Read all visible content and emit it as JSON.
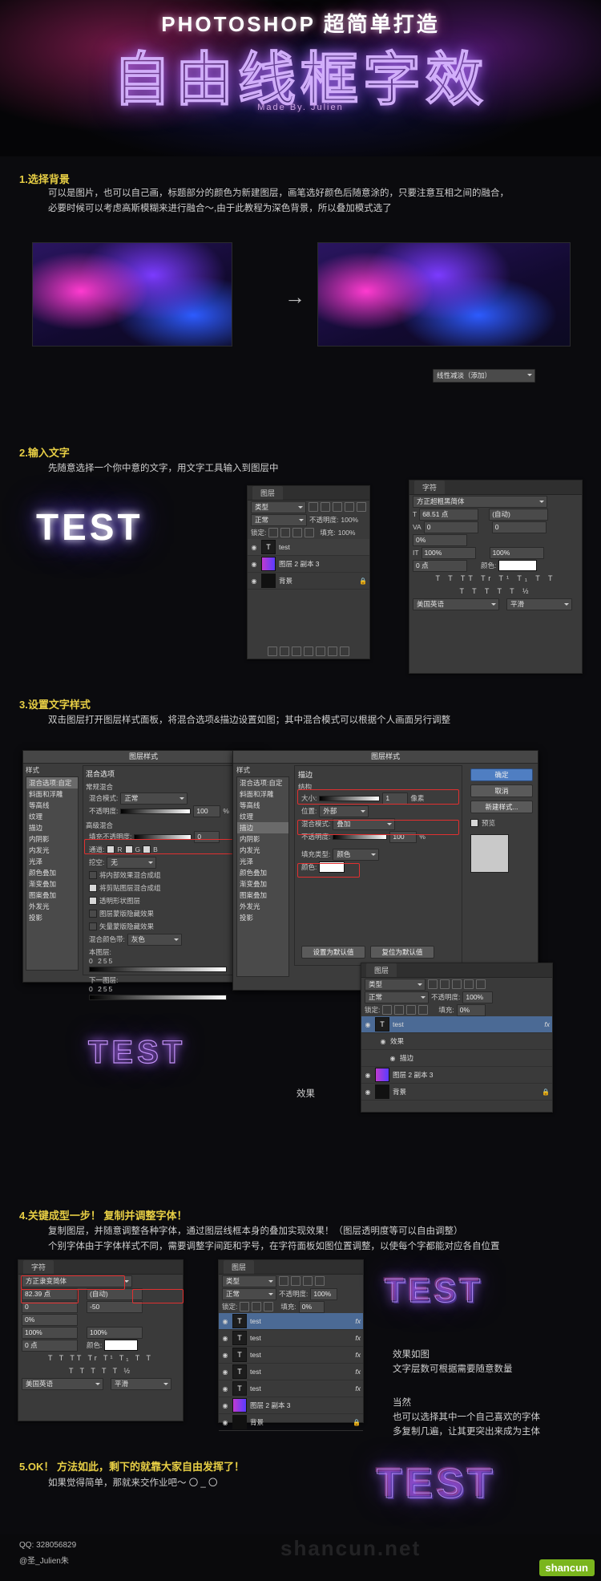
{
  "hero": {
    "title": "PHOTOSHOP  超简单打造",
    "main": "自由线框字效",
    "made_by": "Made By. Julien"
  },
  "steps": [
    {
      "heading": "1.选择背景",
      "body": "可以是图片，也可以自己画，标题部分的颜色为新建图层，画笔选好颜色后随意涂的，只要注意互相之间的融合，\n必要时候可以考虑高斯模糊来进行融合～,由于此教程为深色背景，所以叠加模式选了",
      "blend_mode": "线性减淡（添加）",
      "arrow": "→"
    },
    {
      "heading": "2.输入文字",
      "body": "先随意选择一个你中意的文字，用文字工具输入到图层中",
      "sample_text": "TEST"
    },
    {
      "heading": "3.设置文字样式",
      "body": "双击图层打开图层样式面板，将混合选项&描边设置如图；其中混合模式可以根据个人画面另行调整",
      "result_label": "效果",
      "sample_text": "TEST"
    },
    {
      "heading": "4.关键成型一步！ 复制并调整字体！",
      "body": "复制图层，并随意调整各种字体，通过图层线框本身的叠加实现效果！（图层透明度等可以自由调整）\n个别字体由于字体样式不同，需要调整字间距和字号，在字符面板如图位置调整，以使每个字都能对应各自位置",
      "sample_text": "TEST",
      "note1": "效果如图",
      "note2": "文字层数可根据需要随意数量",
      "note3": "当然",
      "note4": "也可以选择其中一个自己喜欢的字体",
      "note5": "多复制几遍，让其更突出来成为主体"
    },
    {
      "heading": "5.OK！ 方法如此，剩下的就靠大家自由发挥了！",
      "body": "如果觉得简单，那就来交作业吧～  〇 _ 〇",
      "sample_text": "TEST"
    }
  ],
  "panels": {
    "layers_step2": {
      "tab": "图层",
      "filter_kind": "类型",
      "blend_mode": "正常",
      "opacity_label": "不透明度:",
      "opacity_value": "100%",
      "lock_label": "锁定:",
      "fill_label": "填充:",
      "fill_value": "100%",
      "rows": [
        {
          "name": "test",
          "kind": "T"
        },
        {
          "name": "图层 2 副本 3",
          "kind": "img"
        },
        {
          "name": "背景",
          "kind": "bg",
          "locked": "🔒"
        }
      ]
    },
    "character_step2": {
      "tab": "字符",
      "font": "方正超粗黑简体",
      "size_icon": "T",
      "size": "68.51 点",
      "leading": "(自动)",
      "kerning_icon": "VA",
      "kerning": "0",
      "tracking": "0",
      "vscale_icon": "IT",
      "vscale": "100%",
      "hscale": "100%",
      "baseline": "0 点",
      "color_label": "颜色:",
      "percent": "0%",
      "style_row": "T T TT Tr T¹ T₁ T T",
      "frac_row": "T T T T T ½",
      "language": "美国英语",
      "aa": "平滑"
    },
    "layer_style_1": {
      "title": "图层样式",
      "styles_label": "样式",
      "list": [
        "混合选项:自定",
        "斜面和浮雕",
        "等高线",
        "纹理",
        "描边",
        "内阴影",
        "内发光",
        "光泽",
        "颜色叠加",
        "渐变叠加",
        "图案叠加",
        "外发光",
        "投影"
      ],
      "section": "混合选项",
      "general_label": "常规混合",
      "blend_label": "混合模式:",
      "blend_value": "正常",
      "opacity_label": "不透明度:",
      "opacity_value": "100",
      "adv_label": "高级混合",
      "fill_opacity_label": "填充不透明度:",
      "fill_opacity_value": "0",
      "channels_label": "通道:",
      "ch_r": "R",
      "ch_g": "G",
      "ch_b": "B",
      "knockout_label": "挖空:",
      "knockout_value": "无",
      "checks": [
        "将内部效果混合成组",
        "将剪贴图层混合成组",
        "透明形状图层",
        "图层蒙版隐藏效果",
        "矢量蒙版隐藏效果"
      ],
      "blend_if_label": "混合颜色带:",
      "blend_if_value": "灰色",
      "this_layer": "本图层:",
      "this_range": "0        255",
      "under_layer": "下一图层:",
      "under_range": "0        255"
    },
    "layer_style_2": {
      "title": "图层样式",
      "styles_label": "样式",
      "section": "描边",
      "structure_label": "结构",
      "size_label": "大小:",
      "size_value": "1",
      "size_unit": "像素",
      "position_label": "位置:",
      "position_value": "外部",
      "blend_label": "混合模式:",
      "blend_value": "叠加",
      "opacity_label": "不透明度:",
      "opacity_value": "100",
      "fill_type_label": "填充类型:",
      "fill_type_value": "颜色",
      "color_label": "颜色:",
      "reset_default": "设置为默认值",
      "restore_default": "复位为默认值",
      "ok": "确定",
      "cancel": "取消",
      "new_style": "新建样式...",
      "preview": "预览"
    },
    "layers_step3": {
      "tab": "图层",
      "filter_kind": "类型",
      "blend_mode": "正常",
      "opacity_label": "不透明度:",
      "opacity_value": "100%",
      "lock_label": "锁定:",
      "fill_label": "填充:",
      "fill_value": "0%",
      "rows": [
        {
          "name": "test",
          "kind": "T",
          "fx": "fx"
        },
        {
          "name": "效果",
          "kind": "sub"
        },
        {
          "name": "描边",
          "kind": "sub2"
        },
        {
          "name": "图层 2 副本 3",
          "kind": "img"
        },
        {
          "name": "背景",
          "kind": "bg",
          "locked": "🔒"
        }
      ]
    },
    "character_step4": {
      "tab": "字符",
      "font": "方正隶变简体",
      "size": "82.39 点",
      "leading": "(自动)",
      "kerning": "0",
      "tracking": "-50",
      "percent": "0%",
      "vscale": "100%",
      "hscale": "100%",
      "baseline": "0 点",
      "color_label": "颜色:",
      "language": "美国英语",
      "aa": "平滑"
    },
    "layers_step4": {
      "tab": "图层",
      "filter_kind": "类型",
      "blend_mode": "正常",
      "opacity_label": "不透明度:",
      "opacity_value": "100%",
      "lock_label": "锁定:",
      "fill_label": "填充:",
      "fill_value": "0%",
      "rows": [
        {
          "name": "test",
          "kind": "T",
          "fx": "fx"
        },
        {
          "name": "test",
          "kind": "T",
          "fx": "fx"
        },
        {
          "name": "test",
          "kind": "T",
          "fx": "fx"
        },
        {
          "name": "test",
          "kind": "T",
          "fx": "fx"
        },
        {
          "name": "test",
          "kind": "T",
          "fx": "fx"
        },
        {
          "name": "图层 2 副本 3",
          "kind": "img"
        },
        {
          "name": "背景",
          "kind": "bg",
          "locked": "🔒"
        }
      ]
    }
  },
  "footer": {
    "qq": "QQ: 328056829",
    "weibo": "@圣_Julien朱",
    "watermark": "shancun.net",
    "logo": "shancun"
  }
}
